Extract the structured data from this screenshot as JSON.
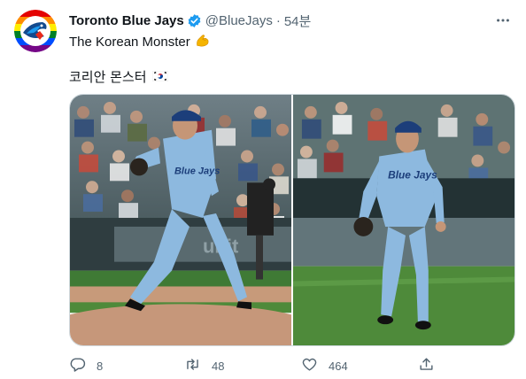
{
  "tweet": {
    "display_name": "Toronto Blue Jays",
    "handle": "@BlueJays",
    "separator": "·",
    "time": "54분",
    "text_line1": "The Korean Monster",
    "text_line2": "코리안 몬스터",
    "flag_emoji_name": "south-korea-flag"
  },
  "actions": {
    "reply_count": "8",
    "retweet_count": "48",
    "like_count": "464"
  },
  "media": {
    "photo_left_jersey": "Blue Jays",
    "photo_right_jersey": "Blue Jays"
  },
  "colors": {
    "accent": "#1d9bf0",
    "jersey_blue": "#8db9df",
    "field_green": "#4e8a3a",
    "secondary_text": "#536471"
  }
}
